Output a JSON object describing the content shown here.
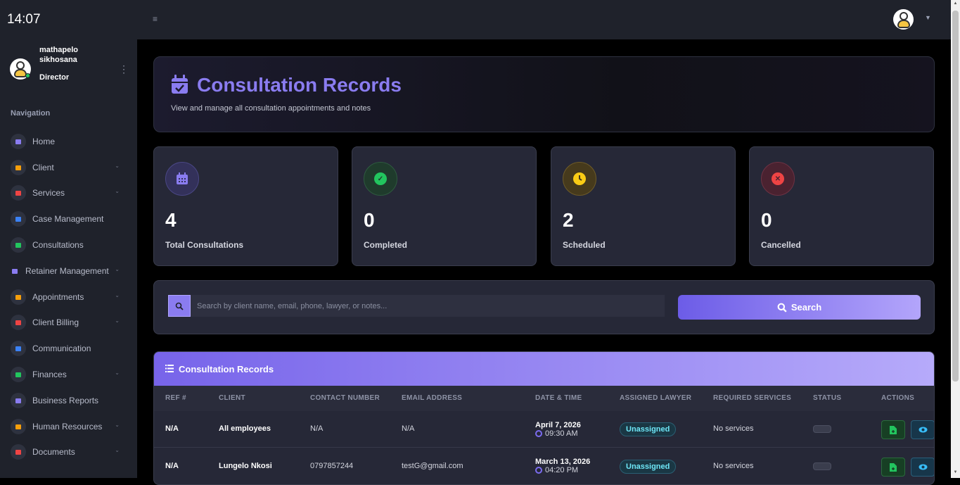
{
  "clock": "14:07",
  "user": {
    "name": "mathapelo sikhosana",
    "role": "Director"
  },
  "nav": {
    "heading": "Navigation",
    "items": [
      {
        "label": "Home",
        "icon": "gauge-icon",
        "color": "#8a7cf0",
        "expandable": false
      },
      {
        "label": "Client",
        "icon": "id-card-icon",
        "color": "#f59e0b",
        "expandable": true
      },
      {
        "label": "Services",
        "icon": "briefcase-icon",
        "color": "#ef4444",
        "expandable": true
      },
      {
        "label": "Case Management",
        "icon": "folder-icon",
        "color": "#3b82f6",
        "expandable": false
      },
      {
        "label": "Consultations",
        "icon": "calendar-check-icon",
        "color": "#22c55e",
        "expandable": false
      },
      {
        "label": "Retainer Management",
        "icon": "file-contract-icon",
        "color": "#8a7cf0",
        "expandable": true
      },
      {
        "label": "Appointments",
        "icon": "calendar-icon",
        "color": "#f59e0b",
        "expandable": true
      },
      {
        "label": "Client Billing",
        "icon": "chart-icon",
        "color": "#ef4444",
        "expandable": true
      },
      {
        "label": "Communication",
        "icon": "chat-icon",
        "color": "#3b82f6",
        "expandable": false
      },
      {
        "label": "Finances",
        "icon": "shield-dollar-icon",
        "color": "#22c55e",
        "expandable": true
      },
      {
        "label": "Business Reports",
        "icon": "bar-chart-icon",
        "color": "#8a7cf0",
        "expandable": false
      },
      {
        "label": "Human Resources",
        "icon": "user-shield-icon",
        "color": "#f59e0b",
        "expandable": true
      },
      {
        "label": "Documents",
        "icon": "document-icon",
        "color": "#ef4444",
        "expandable": true
      }
    ]
  },
  "header": {
    "title": "Consultation Records",
    "subtitle": "View and manage all consultation appointments and notes"
  },
  "stats": [
    {
      "value": "4",
      "label": "Total Consultations",
      "icon": "calendar-icon",
      "color": "#8a7cf0",
      "bg": "#33315a"
    },
    {
      "value": "0",
      "label": "Completed",
      "icon": "check-circle-icon",
      "color": "#22c55e",
      "bg": "#1f3b2c"
    },
    {
      "value": "2",
      "label": "Scheduled",
      "icon": "clock-icon",
      "color": "#facc15",
      "bg": "#463a1c"
    },
    {
      "value": "0",
      "label": "Cancelled",
      "icon": "x-circle-icon",
      "color": "#ef4444",
      "bg": "#4a2230"
    }
  ],
  "search": {
    "placeholder": "Search by client name, email, phone, lawyer, or notes...",
    "button_label": "Search"
  },
  "table": {
    "title": "Consultation Records",
    "columns": [
      "REF #",
      "CLIENT",
      "CONTACT NUMBER",
      "EMAIL ADDRESS",
      "DATE & TIME",
      "ASSIGNED LAWYER",
      "REQUIRED SERVICES",
      "STATUS",
      "ACTIONS"
    ],
    "rows": [
      {
        "ref": "N/A",
        "client": "All employees",
        "contact": "N/A",
        "email": "N/A",
        "date": "April 7, 2026",
        "time": "09:30 AM",
        "lawyer": "Unassigned",
        "services": "No services"
      },
      {
        "ref": "N/A",
        "client": "Lungelo Nkosi",
        "contact": "0797857244",
        "email": "testG@gmail.com",
        "date": "March 13, 2026",
        "time": "04:20 PM",
        "lawyer": "Unassigned",
        "services": "No services"
      }
    ]
  }
}
